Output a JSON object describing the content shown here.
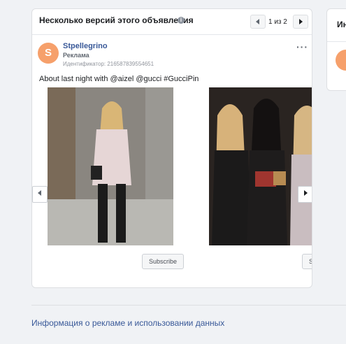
{
  "card": {
    "title": "Несколько версий этого объявления",
    "info_icon": "info-icon",
    "pager": {
      "count": "1 из 2"
    }
  },
  "ad": {
    "avatar_letter": "S",
    "advertiser": "Stpellegrino",
    "label": "Реклама",
    "id_text": "Идентификатор: 216587839554651",
    "more": "···",
    "text": "About last night with @aizel @gucci #GucciPin",
    "subscribe_1": "Subscribe",
    "subscribe_2": "S"
  },
  "side": {
    "title": "Ин"
  },
  "footer": {
    "link": "Информация о рекламе и использовании данных"
  },
  "colors": {
    "link": "#385898",
    "avatar": "#f6a06b",
    "background": "#f0f2f5"
  }
}
